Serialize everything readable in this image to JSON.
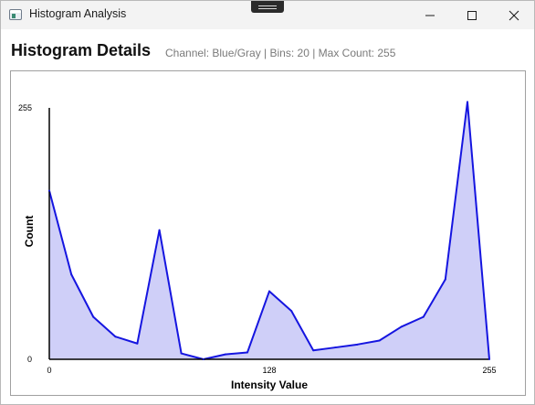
{
  "window": {
    "title": "Histogram Analysis",
    "controls": {
      "minimize_icon": "minimize-icon",
      "maximize_icon": "maximize-icon",
      "close_icon": "close-icon"
    }
  },
  "header": {
    "title": "Histogram Details",
    "subtitle": "Channel: Blue/Gray | Bins: 20 | Max Count: 255"
  },
  "colors": {
    "line": "#1515e0",
    "fill": "#cfcff8",
    "axis": "#000000"
  },
  "chart_data": {
    "type": "area",
    "xlabel": "Intensity Value",
    "ylabel": "Count",
    "xlim": [
      0,
      255
    ],
    "ylim": [
      0,
      255
    ],
    "x_ticks": [
      "0",
      "128",
      "255"
    ],
    "y_ticks": [
      "0",
      "255"
    ],
    "grid": false,
    "series": [
      {
        "x": [
          0,
          12.8,
          25.5,
          38.3,
          51.0,
          63.8,
          76.5,
          89.3,
          102.0,
          114.8,
          127.5,
          140.3,
          153.0,
          165.8,
          178.5,
          191.3,
          204.0,
          216.8,
          229.5,
          242.3,
          255
        ],
        "values": [
          171,
          86,
          43,
          23,
          16,
          131,
          6,
          0,
          5,
          7,
          69,
          49,
          9,
          12,
          15,
          19,
          33,
          43,
          81,
          261,
          0
        ]
      }
    ]
  }
}
